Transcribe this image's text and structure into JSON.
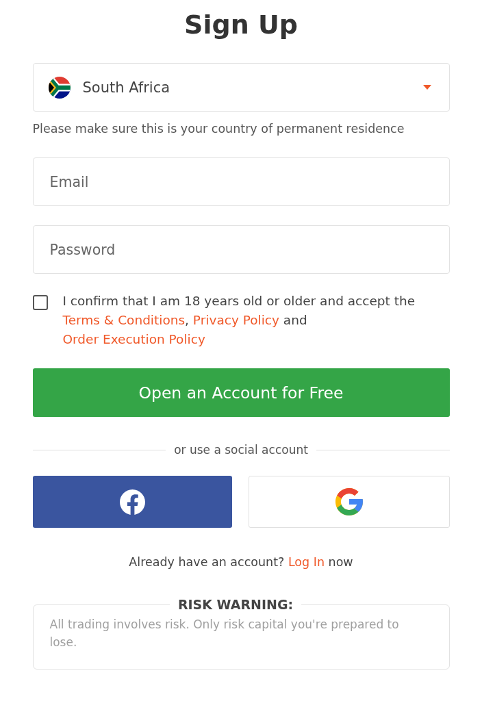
{
  "title": "Sign Up",
  "country": {
    "value": "South Africa",
    "note": "Please make sure this is your country of permanent residence"
  },
  "fields": [
    {
      "placeholder": "Email"
    },
    {
      "placeholder": "Password"
    }
  ],
  "consent": {
    "checked": false,
    "parts": [
      {
        "kind": "text",
        "text": "I confirm that I am 18 years old or older and accept the "
      },
      {
        "kind": "link",
        "text": "Terms & Conditions"
      },
      {
        "kind": "text",
        "text": ", "
      },
      {
        "kind": "link",
        "text": "Privacy Policy"
      },
      {
        "kind": "text",
        "text": " and "
      },
      {
        "kind": "link",
        "text": "Order Execution Policy"
      }
    ]
  },
  "submit_button": "Open an Account for Free",
  "divider_label": "or use a social account",
  "social_buttons": [
    {
      "kind": "facebook"
    },
    {
      "kind": "google"
    }
  ],
  "login_prompt": {
    "parts": [
      {
        "kind": "text",
        "text": "Already have an account? "
      },
      {
        "kind": "link",
        "text": "Log In"
      },
      {
        "kind": "text",
        "text": " now"
      }
    ]
  },
  "risk_warning": {
    "title": "RISK WARNING:",
    "text": "All trading involves risk. Only risk capital you're prepared to lose."
  }
}
